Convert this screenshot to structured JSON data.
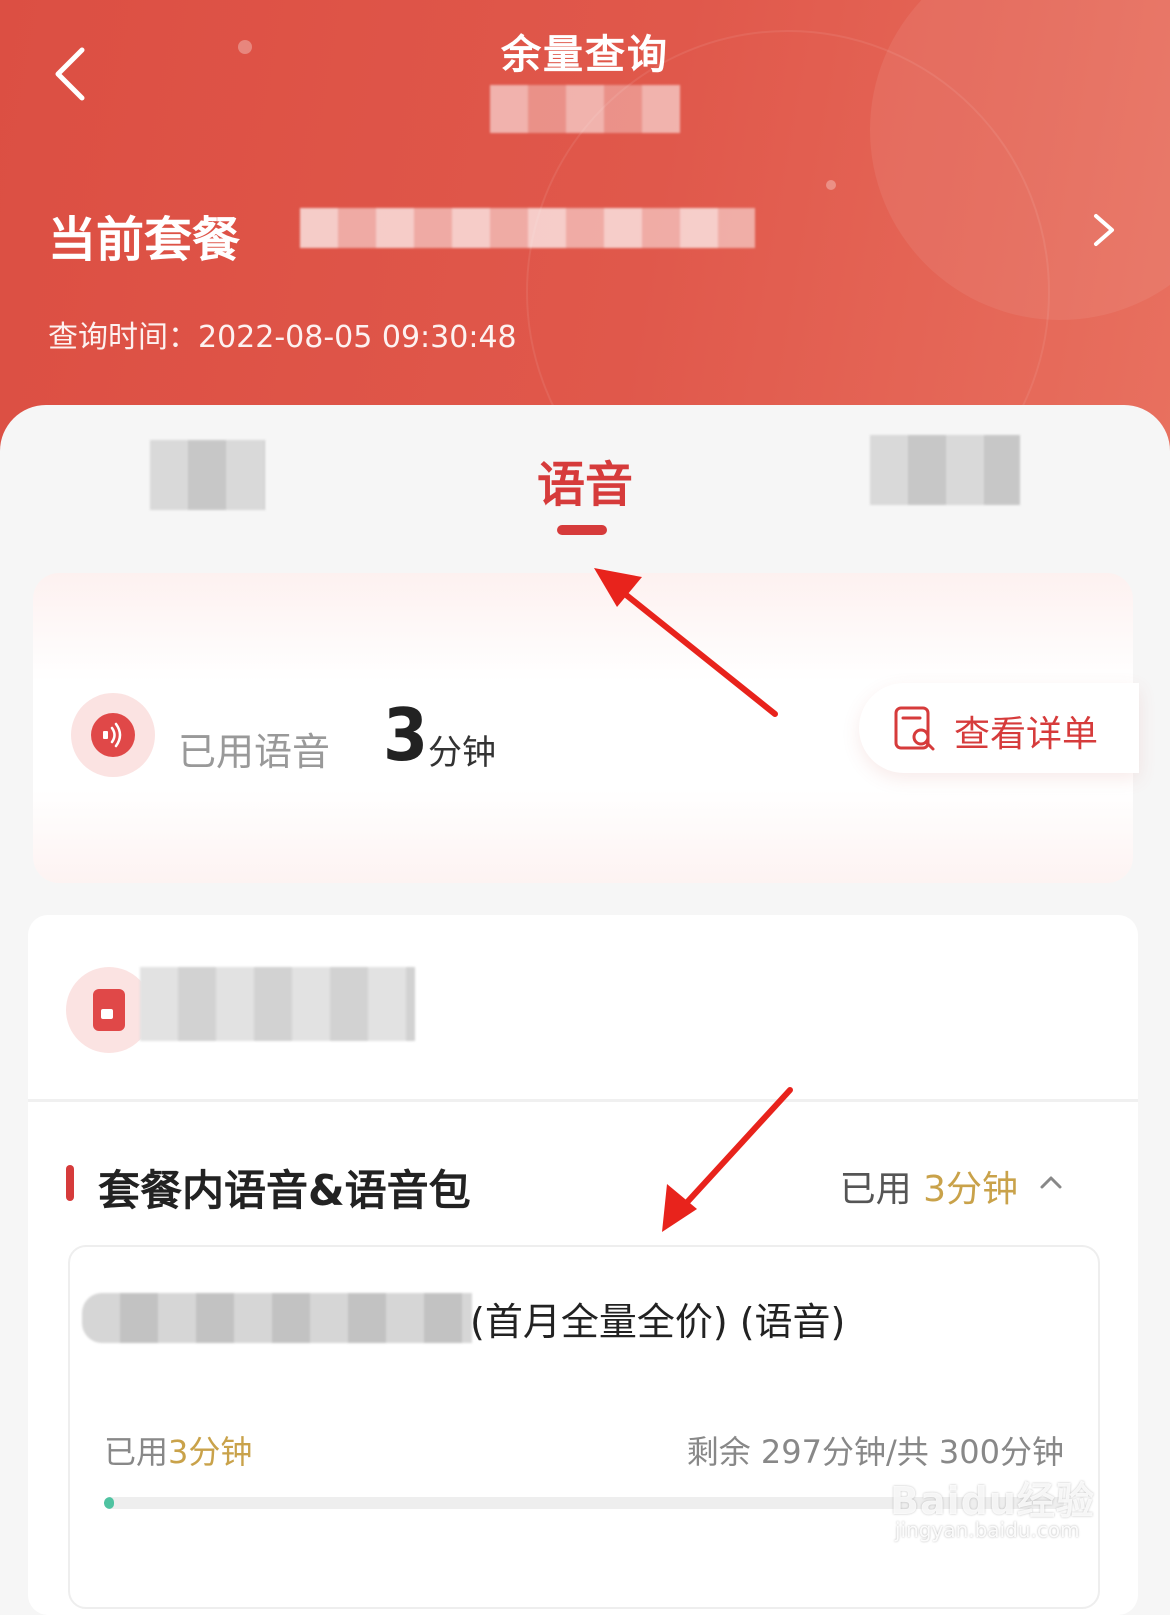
{
  "header": {
    "title": "余量查询",
    "plan_label": "当前套餐",
    "query_time": "查询时间：2022-08-05 09:30:48"
  },
  "tabs": {
    "active_label": "语音"
  },
  "usage_card": {
    "used_label": "已用语音",
    "used_value": "3",
    "used_unit": "分钟",
    "detail_label": "查看详单"
  },
  "package_section": {
    "title": "套餐内语音&语音包",
    "used_prefix": "已用 ",
    "used_value": "3分钟",
    "package": {
      "name_suffix": "(首月全量全价)  (语音)",
      "used_prefix": "已用",
      "used_value": "3分钟",
      "remaining": "剩余 297分钟/共 300分钟",
      "progress_fraction": 0.01
    }
  },
  "watermark": {
    "brand": "Baidu经验",
    "url": "jingyan.baidu.com"
  },
  "colors": {
    "accent": "#d63b3b",
    "header": "#dc4f43",
    "gold": "#c9a24a",
    "progress": "#4fc3a1"
  }
}
